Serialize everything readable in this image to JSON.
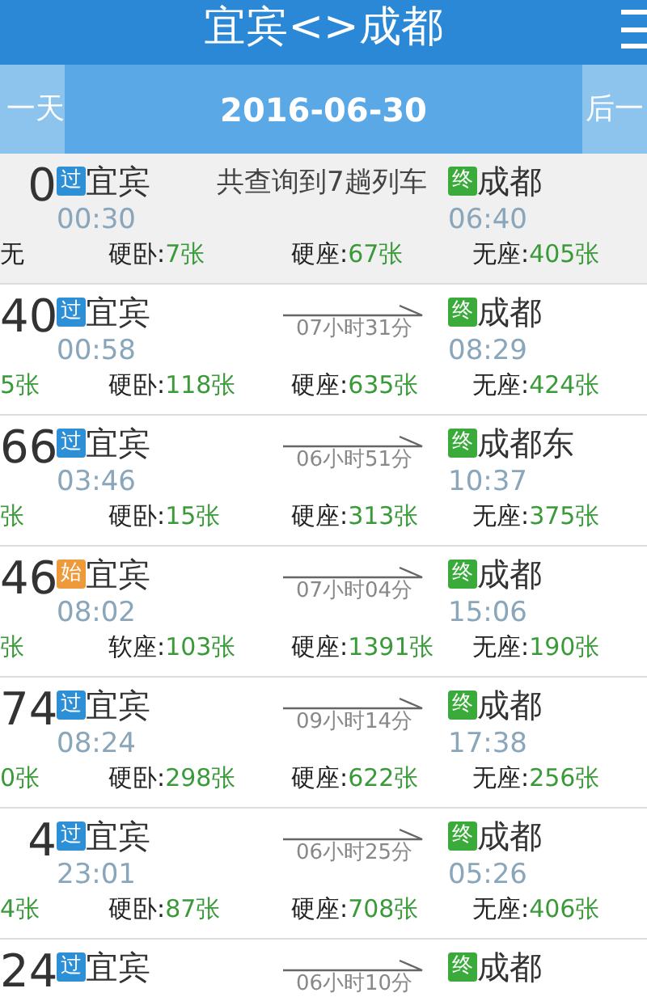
{
  "header": {
    "title": "宜宾<>成都"
  },
  "date_bar": {
    "previous": "一天",
    "date": "2016-06-30",
    "next": "后一"
  },
  "toast": "共查询到7趟列车",
  "trains": [
    {
      "number": "0",
      "from": {
        "badge": "过",
        "kind": "pass",
        "station": "宜宾",
        "time": "00:30"
      },
      "to": {
        "badge": "终",
        "kind": "end",
        "station": "成都",
        "time": "06:40"
      },
      "seats": [
        {
          "label": "无"
        },
        {
          "label": "硬卧:",
          "count": "7张"
        },
        {
          "label": "硬座:",
          "count": "67张"
        },
        {
          "label": "无座:",
          "count": "405张"
        }
      ]
    },
    {
      "number": "40",
      "from": {
        "badge": "过",
        "kind": "pass",
        "station": "宜宾",
        "time": "00:58"
      },
      "duration": "07小时31分",
      "to": {
        "badge": "终",
        "kind": "end",
        "station": "成都",
        "time": "08:29"
      },
      "seats": [
        {
          "count": "5张"
        },
        {
          "label": "硬卧:",
          "count": "118张"
        },
        {
          "label": "硬座:",
          "count": "635张"
        },
        {
          "label": "无座:",
          "count": "424张"
        }
      ]
    },
    {
      "number": "66",
      "from": {
        "badge": "过",
        "kind": "pass",
        "station": "宜宾",
        "time": "03:46"
      },
      "duration": "06小时51分",
      "to": {
        "badge": "终",
        "kind": "end",
        "station": "成都东",
        "time": "10:37"
      },
      "seats": [
        {
          "count": "张"
        },
        {
          "label": "硬卧:",
          "count": "15张"
        },
        {
          "label": "硬座:",
          "count": "313张"
        },
        {
          "label": "无座:",
          "count": "375张"
        }
      ]
    },
    {
      "number": "46",
      "from": {
        "badge": "始",
        "kind": "start",
        "station": "宜宾",
        "time": "08:02"
      },
      "duration": "07小时04分",
      "to": {
        "badge": "终",
        "kind": "end",
        "station": "成都",
        "time": "15:06"
      },
      "seats": [
        {
          "count": "张"
        },
        {
          "label": "软座:",
          "count": "103张"
        },
        {
          "label": "硬座:",
          "count": "1391张"
        },
        {
          "label": "无座:",
          "count": "190张"
        }
      ]
    },
    {
      "number": "74",
      "from": {
        "badge": "过",
        "kind": "pass",
        "station": "宜宾",
        "time": "08:24"
      },
      "duration": "09小时14分",
      "to": {
        "badge": "终",
        "kind": "end",
        "station": "成都",
        "time": "17:38"
      },
      "seats": [
        {
          "count": "0张"
        },
        {
          "label": "硬卧:",
          "count": "298张"
        },
        {
          "label": "硬座:",
          "count": "622张"
        },
        {
          "label": "无座:",
          "count": "256张"
        }
      ]
    },
    {
      "number": "4",
      "from": {
        "badge": "过",
        "kind": "pass",
        "station": "宜宾",
        "time": "23:01"
      },
      "duration": "06小时25分",
      "to": {
        "badge": "终",
        "kind": "end",
        "station": "成都",
        "time": "05:26"
      },
      "seats": [
        {
          "count": "4张"
        },
        {
          "label": "硬卧:",
          "count": "87张"
        },
        {
          "label": "硬座:",
          "count": "708张"
        },
        {
          "label": "无座:",
          "count": "406张"
        }
      ]
    },
    {
      "number": "24",
      "from": {
        "badge": "过",
        "kind": "pass",
        "station": "宜宾"
      },
      "duration": "06小时10分",
      "to": {
        "badge": "终",
        "kind": "end",
        "station": "成都"
      }
    }
  ]
}
